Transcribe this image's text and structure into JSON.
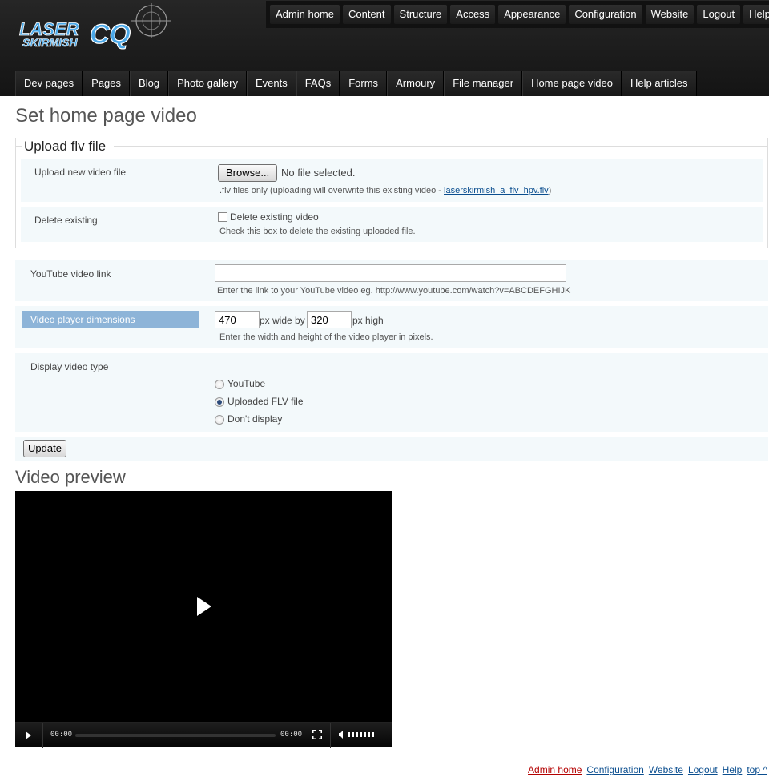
{
  "header": {
    "logo_line1": "LASER",
    "logo_line2": "SKIRMISH",
    "logo_mark": "CQ",
    "top_nav": [
      "Admin home",
      "Content",
      "Structure",
      "Access",
      "Appearance",
      "Configuration",
      "Website",
      "Logout",
      "Help"
    ],
    "main_nav": [
      "Dev pages",
      "Pages",
      "Blog",
      "Photo gallery",
      "Events",
      "FAQs",
      "Forms",
      "Armoury",
      "File manager",
      "Home page video",
      "Help articles"
    ]
  },
  "page": {
    "title": "Set home page video",
    "upload": {
      "legend": "Upload flv file",
      "new_file_label": "Upload new video file",
      "browse_label": "Browse...",
      "no_file": "No file selected.",
      "help_prefix": ".flv files only (uploading will overwrite this existing video - ",
      "existing_file": "laserskirmish_a_flv_hpv.flv",
      "help_suffix": ")",
      "delete_label": "Delete existing",
      "delete_checkbox_label": "Delete existing video",
      "delete_help": "Check this box to delete the existing uploaded file."
    },
    "youtube": {
      "label": "YouTube video link",
      "value": "",
      "help": "Enter the link to your YouTube video eg. http://www.youtube.com/watch?v=ABCDEFGHIJK"
    },
    "dimensions": {
      "label": "Video player dimensions",
      "width": "470",
      "wide_text": "px wide by",
      "height": "320",
      "high_text": "px high",
      "help": "Enter the width and height of the video player in pixels."
    },
    "display_type": {
      "label": "Display video type",
      "options": [
        "YouTube",
        "Uploaded FLV file",
        "Don't display"
      ],
      "selected": "Uploaded FLV file"
    },
    "update_label": "Update",
    "preview_title": "Video preview",
    "player": {
      "current_time": "00:00",
      "duration": "00:00"
    }
  },
  "footer": {
    "links": [
      "Admin home",
      "Configuration",
      "Website",
      "Logout",
      "Help",
      "top ^"
    ]
  },
  "colors": {
    "header_bg": "#1a1a1a",
    "highlight": "#8db4d8",
    "row_bg": "#f3f9fb",
    "link": "#0b4e8f",
    "active_link": "#b40000"
  }
}
